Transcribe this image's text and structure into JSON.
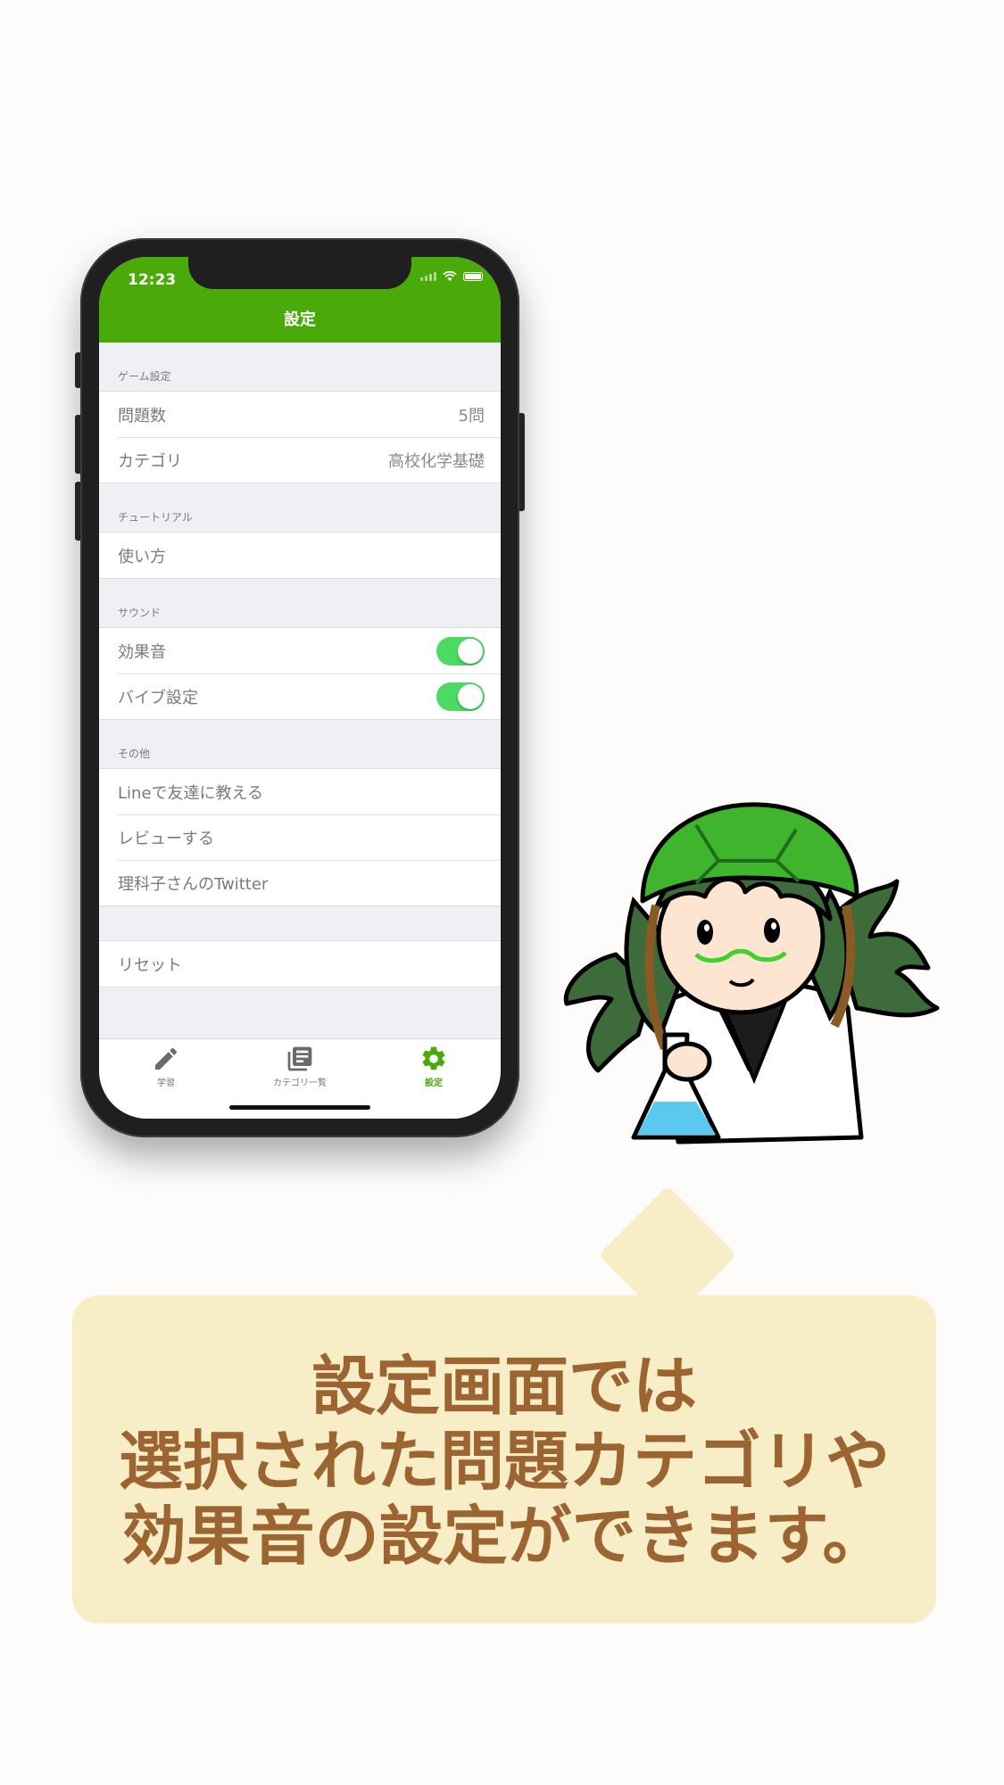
{
  "status_bar": {
    "time": "12:23"
  },
  "navbar": {
    "title": "設定"
  },
  "sections": [
    {
      "header": "ゲーム設定",
      "rows": [
        {
          "label": "問題数",
          "value": "5問"
        },
        {
          "label": "カテゴリ",
          "value": "高校化学基礎"
        }
      ]
    },
    {
      "header": "チュートリアル",
      "rows": [
        {
          "label": "使い方"
        }
      ]
    },
    {
      "header": "サウンド",
      "rows": [
        {
          "label": "効果音",
          "toggle": true
        },
        {
          "label": "バイブ設定",
          "toggle": true
        }
      ]
    },
    {
      "header": "その他",
      "rows": [
        {
          "label": "Lineで友達に教える"
        },
        {
          "label": "レビューする"
        },
        {
          "label": "理科子さんのTwitter"
        }
      ]
    },
    {
      "header": "",
      "rows": [
        {
          "label": "リセット"
        }
      ]
    }
  ],
  "tabbar": {
    "tabs": [
      {
        "label": "学習",
        "icon": "pencil-icon",
        "active": false
      },
      {
        "label": "カテゴリ一覧",
        "icon": "book-list-icon",
        "active": false
      },
      {
        "label": "設定",
        "icon": "gear-icon",
        "active": true
      }
    ]
  },
  "colors": {
    "accent": "#4aaa0a",
    "toggle_on": "#4cd964",
    "bubble": "#f7edc6",
    "bubble_text": "#9b6431"
  },
  "caption": {
    "lines": [
      "設定画面では",
      "選択された問題カテゴリや",
      "効果音の設定ができます。"
    ]
  }
}
